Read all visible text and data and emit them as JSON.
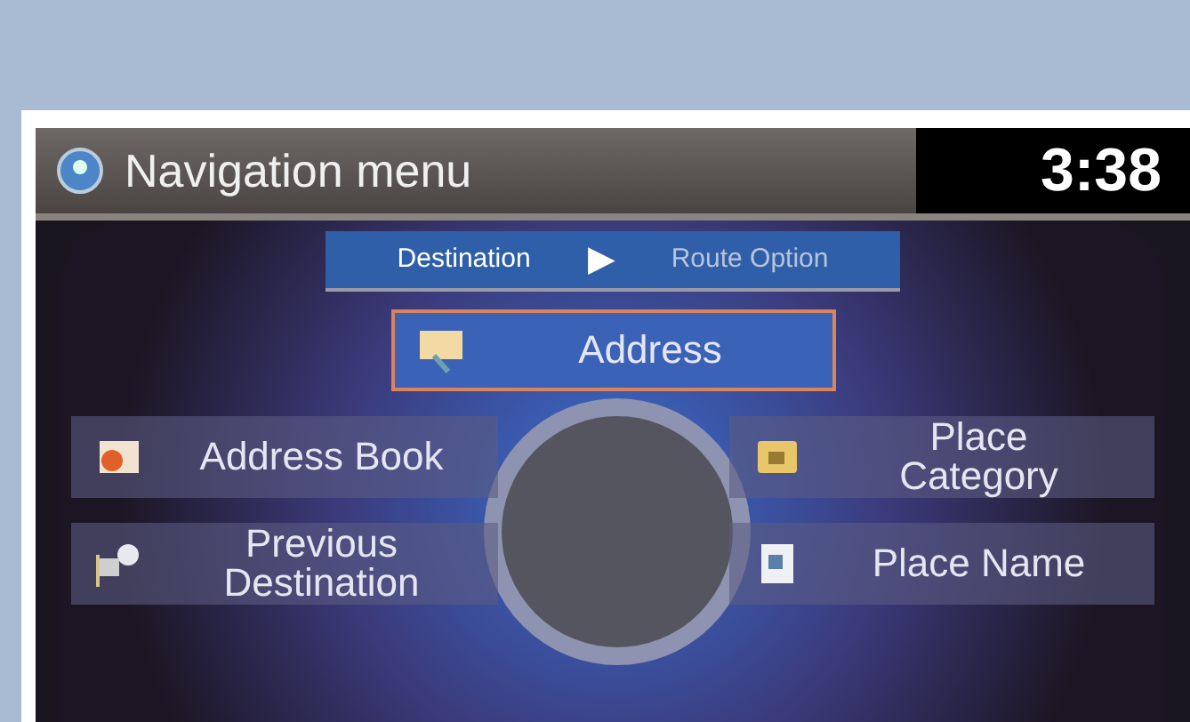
{
  "header": {
    "title": "Navigation menu",
    "time": "3:38"
  },
  "tabs": [
    {
      "label": "Destination",
      "selected": true
    },
    {
      "label": "Route Option",
      "selected": false
    }
  ],
  "separator": "▶",
  "menu": [
    {
      "label": "Address",
      "selected": true
    },
    {
      "label": "Address Book",
      "selected": false
    },
    {
      "label": "Place Category",
      "selected": false
    },
    {
      "label": "Previous Destination",
      "selected": false
    },
    {
      "label": "Place Name",
      "selected": false
    }
  ]
}
